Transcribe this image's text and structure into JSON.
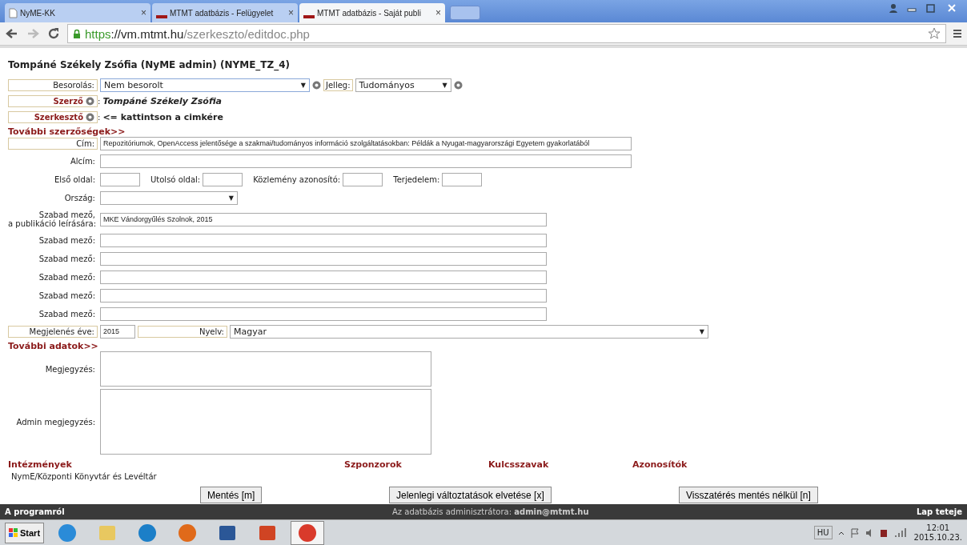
{
  "browser": {
    "tabs": [
      {
        "title": "NyME-KK",
        "kind": "page",
        "selected": false
      },
      {
        "title": "MTMT adatbázis - Felügyelet",
        "kind": "site",
        "selected": false
      },
      {
        "title": "MTMT adatbázis - Saját publi",
        "kind": "site",
        "selected": true
      }
    ],
    "tab_close": "×",
    "url": {
      "scheme": "https",
      "rest_host": "://vm.mtmt.hu",
      "path": "/szerkeszto/editdoc.php"
    }
  },
  "dropdown_arrow": "▼",
  "page_title": "Tompáné Székely Zsófia (NyME admin) (NYME_TZ_4)",
  "classification": {
    "label": "Besorolás:",
    "value": "Nem besorolt",
    "type_label": "Jelleg:",
    "type_value": "Tudományos"
  },
  "people": [
    {
      "label": "Szerző",
      "suffix": ":",
      "value": "Tompáné Székely Zsófia",
      "kind": "name"
    },
    {
      "label": "Szerkesztő",
      "suffix": ":",
      "value": "<= kattintson a cimkére",
      "kind": "hint"
    }
  ],
  "more_authors_link": "További szerzőségek>>",
  "text_fields": [
    {
      "label": "Cím:",
      "value": "Repozitóriumok, OpenAccess jelentősége a szakmai/tudományos információ szolgáltatásokban: Példák a Nyugat-magyarországi Egyetem gyakorlatából",
      "boxed": true
    },
    {
      "label": "Alcím:",
      "boxed": false
    }
  ],
  "page_fields": [
    {
      "label": "Első oldal:"
    },
    {
      "label": "Utolsó oldal:"
    },
    {
      "label": "Közlemény azonosító:"
    },
    {
      "label": "Terjedelem:"
    }
  ],
  "country": {
    "label": "Ország:"
  },
  "free_fields": [
    {
      "label": [
        "Szabad mező,",
        "a publikáció leírására:"
      ],
      "value": "MKE Vándorgyűlés Szolnok, 2015"
    },
    {
      "label": [
        "Szabad mező:"
      ]
    },
    {
      "label": [
        "Szabad mező:"
      ]
    },
    {
      "label": [
        "Szabad mező:"
      ]
    },
    {
      "label": [
        "Szabad mező:"
      ]
    },
    {
      "label": [
        "Szabad mező:"
      ]
    }
  ],
  "year": {
    "label": "Megjelenés éve:",
    "value": "2015"
  },
  "language": {
    "label": "Nyelv:",
    "value": "Magyar"
  },
  "more_data_link": "További adatok>>",
  "notes": [
    {
      "label": "Megjegyzés:",
      "kind": "small"
    },
    {
      "label": "Admin megjegyzés:",
      "kind": "large"
    }
  ],
  "sections": [
    {
      "title": "Intézmények",
      "items": [
        "NymE/Központi Könyvtár és Levéltár"
      ]
    },
    {
      "title": "Szponzorok"
    },
    {
      "title": "Kulcsszavak"
    },
    {
      "title": "Azonosítók"
    }
  ],
  "buttons": [
    "Mentés [m]",
    "Jelenlegi változtatások elvetése [x]",
    "Visszatérés mentés nélkül [n]"
  ],
  "footer": {
    "left": "A programról",
    "center": "Az adatbázis adminisztrátora: **admin@mtmt.hu**",
    "right": "Lap teteje"
  },
  "taskbar": {
    "start": "Start",
    "apps": [
      {
        "kind": "ie",
        "selected": false
      },
      {
        "kind": "folder",
        "selected": false
      },
      {
        "kind": "media",
        "selected": false
      },
      {
        "kind": "firefox",
        "selected": false
      },
      {
        "kind": "word",
        "selected": false
      },
      {
        "kind": "powerpoint",
        "selected": false
      },
      {
        "kind": "chrome",
        "selected": true
      }
    ],
    "language": "HU",
    "time": "12:01",
    "date": "2015.10.23."
  }
}
